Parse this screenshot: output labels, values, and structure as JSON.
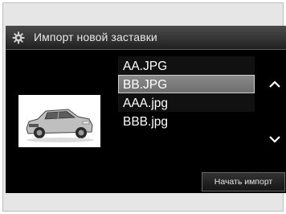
{
  "window": {
    "title": "Импорт новой заставки",
    "title_icon": "gear-icon"
  },
  "files": [
    {
      "name": "AA.JPG",
      "selected": false
    },
    {
      "name": "BB.JPG",
      "selected": true
    },
    {
      "name": "AAA.jpg",
      "selected": false
    },
    {
      "name": "BBB.jpg",
      "selected": false
    }
  ],
  "preview": {
    "subject": "car-preview-image"
  },
  "scroll": {
    "up_icon": "chevron-up-icon",
    "down_icon": "chevron-down-icon"
  },
  "actions": {
    "import_label": "Начать импорт"
  },
  "colors": {
    "screen_bg": "#000000",
    "titlebar_bg": "#3a3a3a",
    "selection_bg": "#7a7a7a",
    "text": "#ffffff"
  }
}
